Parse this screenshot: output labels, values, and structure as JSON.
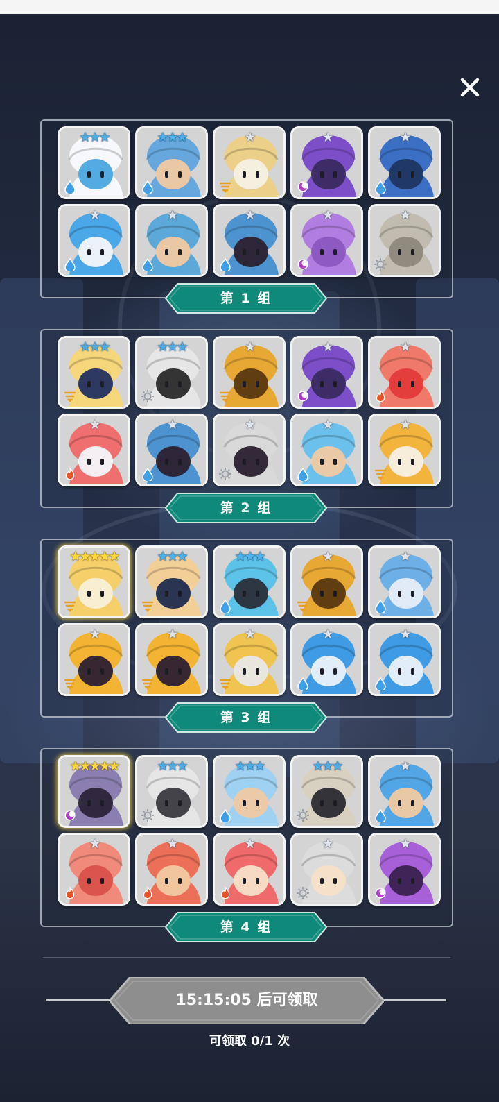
{
  "close_icon": "close-icon",
  "colors": {
    "label_bg": "#0f8a7a",
    "label_border": "#cfe8e4",
    "water": "#3fa0e8",
    "dark": "#b23cc8",
    "fire": "#e8542a",
    "light": "#9aa0a8",
    "wind": "#e9a020"
  },
  "groups": [
    {
      "label": "第 1 组",
      "heroes": [
        {
          "name": "rabbit-hero",
          "stars": "★★★",
          "star_color": "blue",
          "element": "water",
          "color": "#f7f8fb",
          "accent": "#4aa7e0"
        },
        {
          "name": "blue-hair-hero",
          "stars": "★★★",
          "star_color": "blue",
          "element": "water",
          "color": "#66a8dd",
          "accent": "#f1c9a2"
        },
        {
          "name": "bandaged-hero",
          "stars": "★",
          "star_color": "silver",
          "element": "wind",
          "color": "#ecd08a",
          "accent": "#f6f0e4"
        },
        {
          "name": "purple-ghost-hero",
          "stars": "★",
          "star_color": "silver",
          "element": "dark",
          "color": "#7c4fc9",
          "accent": "#3a2a60"
        },
        {
          "name": "blue-skull-hero",
          "stars": "★",
          "star_color": "silver",
          "element": "water",
          "color": "#3b6fc4",
          "accent": "#1e3560"
        },
        {
          "name": "blue-cat-hero",
          "stars": "★",
          "star_color": "silver",
          "element": "water",
          "color": "#4aa7e8",
          "accent": "#f2f4f8"
        },
        {
          "name": "blue-knight-hero",
          "stars": "★",
          "star_color": "silver",
          "element": "water",
          "color": "#5ca8d8",
          "accent": "#f1c9a2"
        },
        {
          "name": "blue-witch-hero",
          "stars": "★",
          "star_color": "silver",
          "element": "water",
          "color": "#4d93cf",
          "accent": "#2b2030"
        },
        {
          "name": "purple-moai-hero",
          "stars": "★",
          "star_color": "silver",
          "element": "dark",
          "color": "#b07ee0",
          "accent": "#8a58c0"
        },
        {
          "name": "bone-totem-hero",
          "stars": "★",
          "star_color": "silver",
          "element": "light",
          "color": "#c2bcb0",
          "accent": "#8e887c"
        }
      ]
    },
    {
      "label": "第 2 组",
      "heroes": [
        {
          "name": "blonde-masked-hero",
          "stars": "★★★",
          "star_color": "blue",
          "element": "wind",
          "color": "#f6d67a",
          "accent": "#233060"
        },
        {
          "name": "mummy-hero",
          "stars": "★★★",
          "star_color": "blue",
          "element": "light",
          "color": "#e6e6e6",
          "accent": "#2a2a2a"
        },
        {
          "name": "tree-stump-hero",
          "stars": "★",
          "star_color": "silver",
          "element": "wind",
          "color": "#e8a834",
          "accent": "#5a3810"
        },
        {
          "name": "purple-ghost-hero-2",
          "stars": "★",
          "star_color": "silver",
          "element": "dark",
          "color": "#7c4fc9",
          "accent": "#3a2a60"
        },
        {
          "name": "red-bow-hero",
          "stars": "★",
          "star_color": "silver",
          "element": "fire",
          "color": "#ef7a6a",
          "accent": "#e23a3a"
        },
        {
          "name": "red-cat-hero",
          "stars": "★",
          "star_color": "silver",
          "element": "fire",
          "color": "#ef6f6f",
          "accent": "#f2f4f8"
        },
        {
          "name": "blue-witch-hero-2",
          "stars": "★",
          "star_color": "silver",
          "element": "water",
          "color": "#4d93cf",
          "accent": "#2b2030"
        },
        {
          "name": "white-witch-hero",
          "stars": "★",
          "star_color": "silver",
          "element": "light",
          "color": "#d9d9d9",
          "accent": "#2b2030"
        },
        {
          "name": "blue-cyclops-girl-hero",
          "stars": "★",
          "star_color": "silver",
          "element": "water",
          "color": "#6cc1ec",
          "accent": "#f1c9a2"
        },
        {
          "name": "orange-pirate-hero",
          "stars": "★",
          "star_color": "silver",
          "element": "wind",
          "color": "#f2b43c",
          "accent": "#f6f0e4"
        }
      ]
    },
    {
      "label": "第 3 组",
      "heroes": [
        {
          "name": "golden-priestess-hero",
          "stars": "★★★★★",
          "star_color": "gold",
          "element": "wind",
          "color": "#f5cf6a",
          "accent": "#f8efd8",
          "gold": true
        },
        {
          "name": "bandaged-boy-hero",
          "stars": "★★★",
          "star_color": "blue",
          "element": "wind",
          "color": "#f3cf98",
          "accent": "#1f2d4d"
        },
        {
          "name": "cyan-bird-hero",
          "stars": "★★★",
          "star_color": "blue",
          "element": "water",
          "color": "#5dc2e8",
          "accent": "#2a2e3a"
        },
        {
          "name": "tree-stump-hero-2",
          "stars": "★",
          "star_color": "silver",
          "element": "wind",
          "color": "#e8a834",
          "accent": "#5a3810"
        },
        {
          "name": "cloud-ghost-hero",
          "stars": "★",
          "star_color": "silver",
          "element": "water",
          "color": "#6db0e8",
          "accent": "#e8eef8"
        },
        {
          "name": "yellow-witch-hero",
          "stars": "★",
          "star_color": "silver",
          "element": "wind",
          "color": "#f2b432",
          "accent": "#2b2030"
        },
        {
          "name": "yellow-witch-hero-2",
          "stars": "★",
          "star_color": "silver",
          "element": "wind",
          "color": "#f2b432",
          "accent": "#2b2030"
        },
        {
          "name": "winged-knight-hero",
          "stars": "★",
          "star_color": "silver",
          "element": "wind",
          "color": "#f0c450",
          "accent": "#e8e8e8"
        },
        {
          "name": "ice-dragon-hero",
          "stars": "★",
          "star_color": "silver",
          "element": "water",
          "color": "#3f9be3",
          "accent": "#eaf2fb"
        },
        {
          "name": "ice-dragon-hero-2",
          "stars": "★",
          "star_color": "silver",
          "element": "water",
          "color": "#3f9be3",
          "accent": "#eaf2fb"
        }
      ]
    },
    {
      "label": "第 4 组",
      "heroes": [
        {
          "name": "dark-knight-hero",
          "stars": "★★★★★",
          "star_color": "gold",
          "element": "dark",
          "color": "#8a7fb0",
          "accent": "#2a2438",
          "gold": true
        },
        {
          "name": "white-wolf-hero",
          "stars": "★★★",
          "star_color": "blue",
          "element": "light",
          "color": "#e6e6e6",
          "accent": "#3a3a40"
        },
        {
          "name": "ice-maiden-hero",
          "stars": "★★★",
          "star_color": "blue",
          "element": "water",
          "color": "#9fd2f2",
          "accent": "#f1c9a2"
        },
        {
          "name": "eye-totem-hero",
          "stars": "★★★",
          "star_color": "blue",
          "element": "light",
          "color": "#d8d0c0",
          "accent": "#2a2a30"
        },
        {
          "name": "blue-bow-hero",
          "stars": "★",
          "star_color": "silver",
          "element": "water",
          "color": "#52a6e6",
          "accent": "#f1c9a2"
        },
        {
          "name": "red-shell-hero",
          "stars": "★",
          "star_color": "silver",
          "element": "fire",
          "color": "#f08a7a",
          "accent": "#d8504a"
        },
        {
          "name": "red-knight-hero",
          "stars": "★",
          "star_color": "silver",
          "element": "fire",
          "color": "#ec7058",
          "accent": "#f1c9a2"
        },
        {
          "name": "red-horned-hero",
          "stars": "★",
          "star_color": "silver",
          "element": "fire",
          "color": "#ef6a6a",
          "accent": "#f6e0c8"
        },
        {
          "name": "white-horned-hero",
          "stars": "★",
          "star_color": "silver",
          "element": "light",
          "color": "#dcdcdc",
          "accent": "#f6e0c8"
        },
        {
          "name": "purple-chest-hero",
          "stars": "★",
          "star_color": "silver",
          "element": "dark",
          "color": "#a860d8",
          "accent": "#3a2050"
        }
      ]
    }
  ],
  "timer": {
    "label": "15:15:05 后可领取"
  },
  "claim": {
    "label": "可领取 0/1 次"
  }
}
